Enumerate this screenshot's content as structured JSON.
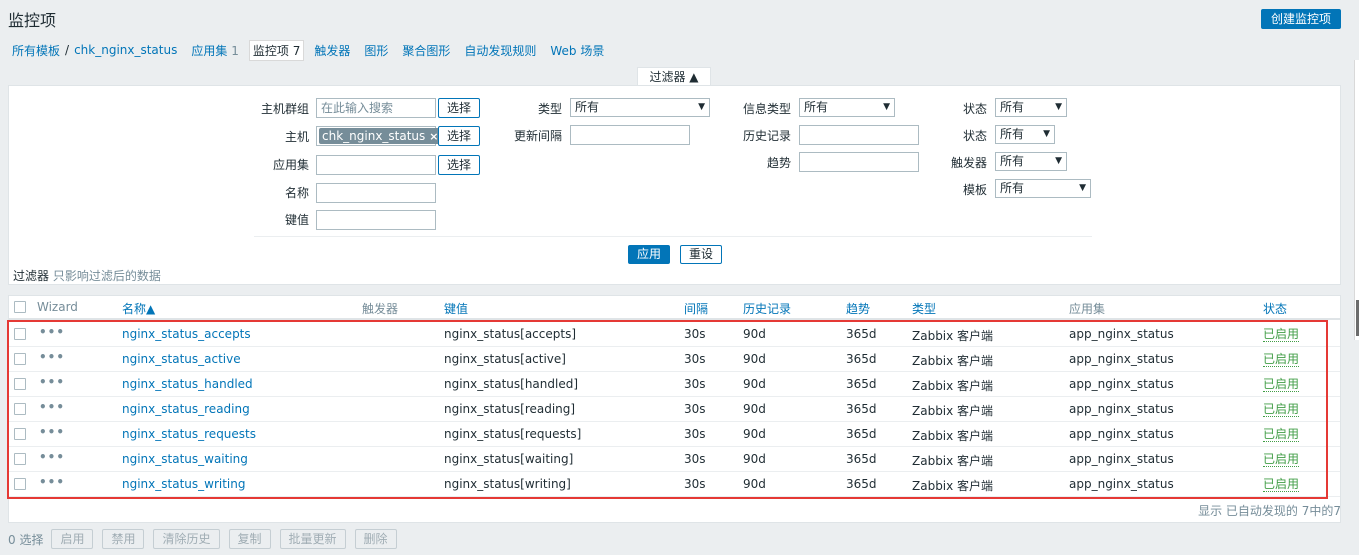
{
  "header": {
    "title": "监控项",
    "create_label": "创建监控项"
  },
  "nav": {
    "all_templates": "所有模板",
    "separator": "/",
    "template": "chk_nginx_status",
    "applications": {
      "label": "应用集",
      "count": "1"
    },
    "items": {
      "label": "监控项",
      "count": "7"
    },
    "triggers": "触发器",
    "graphs": "图形",
    "screens": "聚合图形",
    "discovery": "自动发现规则",
    "web": "Web 场景"
  },
  "filter": {
    "tab_label": "过滤器 ▲",
    "host_group_label": "主机群组",
    "host_group_placeholder": "在此输入搜索",
    "select_label": "选择",
    "host_label": "主机",
    "host_tag": "chk_nginx_status",
    "application_label": "应用集",
    "name_label": "名称",
    "key_label": "键值",
    "type_label": "类型",
    "type_value": "所有",
    "interval_label": "更新间隔",
    "info_type_label": "信息类型",
    "info_type_value": "所有",
    "history_label": "历史记录",
    "trends_label": "趋势",
    "state_label": "状态",
    "state_value": "所有",
    "status_label": "状态",
    "status_value": "所有",
    "triggers_label": "触发器",
    "triggers_value": "所有",
    "template_label": "模板",
    "template_value": "所有",
    "apply_label": "应用",
    "reset_label": "重设",
    "note_prefix": "过滤器",
    "note_text": "只影响过滤后的数据"
  },
  "table": {
    "headers": {
      "wizard": "Wizard",
      "name": "名称▲",
      "triggers": "触发器",
      "key": "键值",
      "interval": "间隔",
      "history": "历史记录",
      "trends": "趋势",
      "type": "类型",
      "application": "应用集",
      "status": "状态"
    },
    "rows": [
      {
        "wizard": "•••",
        "name": "nginx_status_accepts",
        "key": "nginx_status[accepts]",
        "interval": "30s",
        "history": "90d",
        "trends": "365d",
        "type": "Zabbix 客户端",
        "application": "app_nginx_status",
        "status": "已启用"
      },
      {
        "wizard": "•••",
        "name": "nginx_status_active",
        "key": "nginx_status[active]",
        "interval": "30s",
        "history": "90d",
        "trends": "365d",
        "type": "Zabbix 客户端",
        "application": "app_nginx_status",
        "status": "已启用"
      },
      {
        "wizard": "•••",
        "name": "nginx_status_handled",
        "key": "nginx_status[handled]",
        "interval": "30s",
        "history": "90d",
        "trends": "365d",
        "type": "Zabbix 客户端",
        "application": "app_nginx_status",
        "status": "已启用"
      },
      {
        "wizard": "•••",
        "name": "nginx_status_reading",
        "key": "nginx_status[reading]",
        "interval": "30s",
        "history": "90d",
        "trends": "365d",
        "type": "Zabbix 客户端",
        "application": "app_nginx_status",
        "status": "已启用"
      },
      {
        "wizard": "•••",
        "name": "nginx_status_requests",
        "key": "nginx_status[requests]",
        "interval": "30s",
        "history": "90d",
        "trends": "365d",
        "type": "Zabbix 客户端",
        "application": "app_nginx_status",
        "status": "已启用"
      },
      {
        "wizard": "•••",
        "name": "nginx_status_waiting",
        "key": "nginx_status[waiting]",
        "interval": "30s",
        "history": "90d",
        "trends": "365d",
        "type": "Zabbix 客户端",
        "application": "app_nginx_status",
        "status": "已启用"
      },
      {
        "wizard": "•••",
        "name": "nginx_status_writing",
        "key": "nginx_status[writing]",
        "interval": "30s",
        "history": "90d",
        "trends": "365d",
        "type": "Zabbix 客户端",
        "application": "app_nginx_status",
        "status": "已启用"
      }
    ],
    "footer_info": "显示 已自动发现的 7中的7"
  },
  "actions": {
    "selected": "0 选择",
    "enable": "启用",
    "disable": "禁用",
    "clear_history": "清除历史",
    "copy": "复制",
    "mass_update": "批量更新",
    "delete": "删除"
  },
  "colors": {
    "link": "#0275b8",
    "enabled": "#429e47",
    "highlight": "#e53935"
  }
}
